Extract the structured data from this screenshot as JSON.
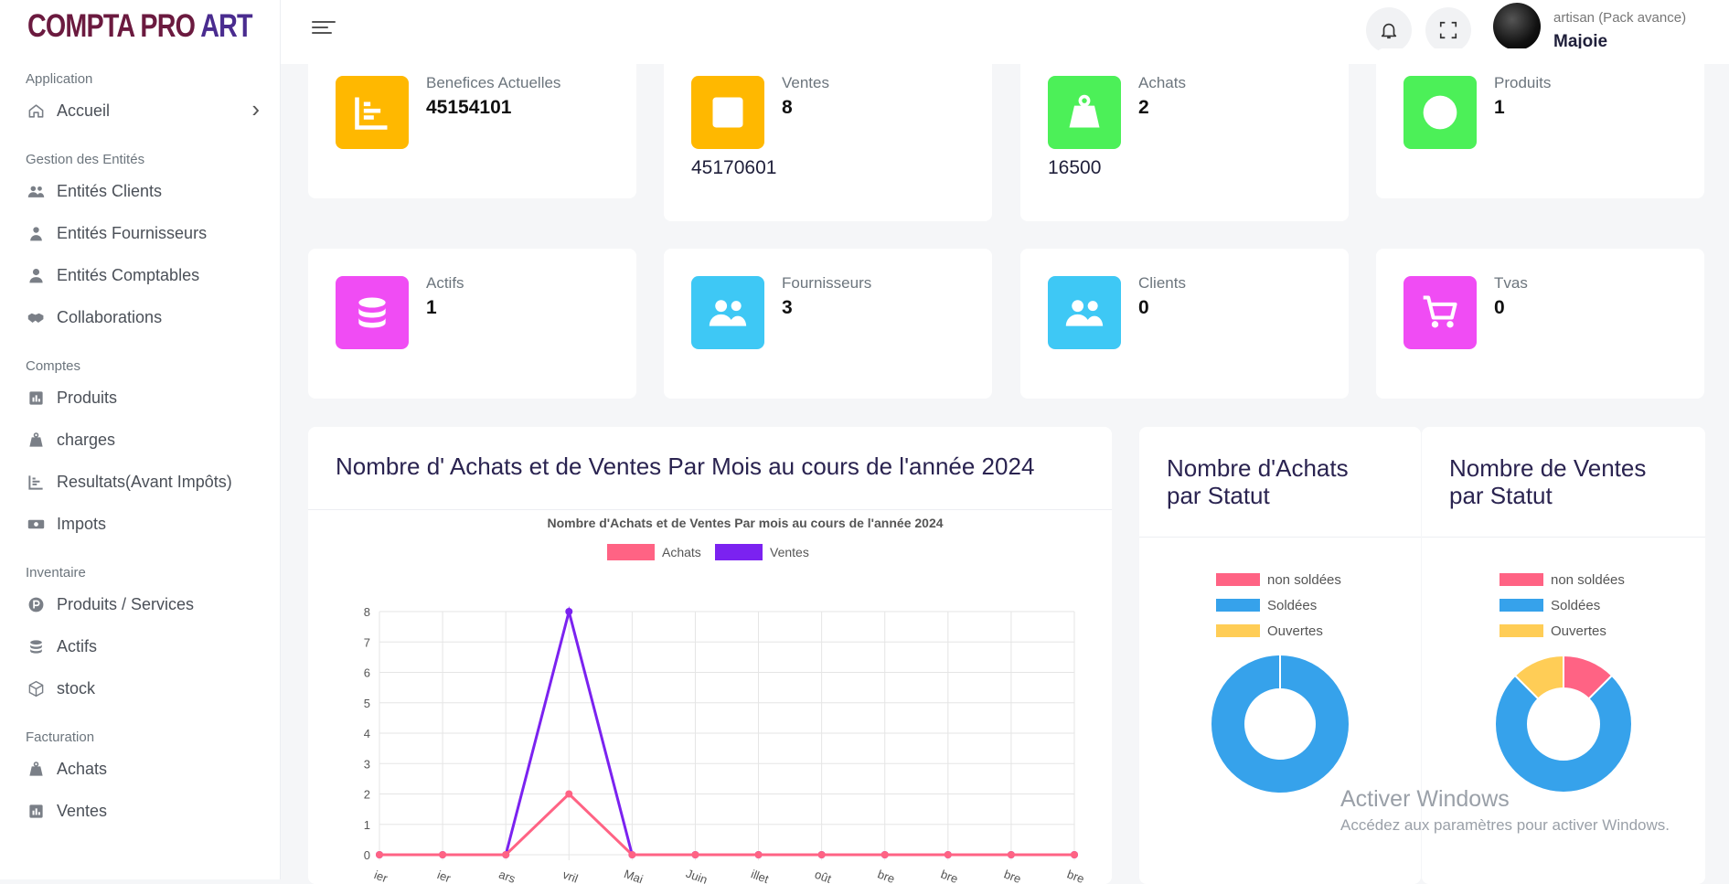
{
  "brand": {
    "name_main": "COMPTA PRO",
    "name_accent": "ART"
  },
  "sidebar": {
    "sections": [
      {
        "title": "Application",
        "items": [
          {
            "label": "Accueil",
            "icon": "home-icon"
          }
        ]
      },
      {
        "title": "Gestion des Entités",
        "items": [
          {
            "label": "Entités Clients",
            "icon": "users-icon"
          },
          {
            "label": "Entités Fournisseurs",
            "icon": "user-tie-icon"
          },
          {
            "label": "Entités Comptables",
            "icon": "user-icon"
          },
          {
            "label": "Collaborations",
            "icon": "handshake-icon"
          }
        ]
      },
      {
        "title": "Comptes",
        "items": [
          {
            "label": "Produits",
            "icon": "chart-bar-icon"
          },
          {
            "label": "charges",
            "icon": "weight-icon"
          },
          {
            "label": "Resultats(Avant Impôts)",
            "icon": "chart-line-icon"
          },
          {
            "label": "Impots",
            "icon": "money-icon"
          }
        ]
      },
      {
        "title": "Inventaire",
        "items": [
          {
            "label": "Produits / Services",
            "icon": "product-p-icon"
          },
          {
            "label": "Actifs",
            "icon": "coins-icon"
          },
          {
            "label": "stock",
            "icon": "box-icon"
          }
        ]
      },
      {
        "title": "Facturation",
        "items": [
          {
            "label": "Achats",
            "icon": "weight-icon"
          },
          {
            "label": "Ventes",
            "icon": "chart-bar-icon"
          }
        ]
      }
    ]
  },
  "topbar": {
    "user_role": "artisan (Pack avance)",
    "user_name": "Majoie"
  },
  "stats_row1": [
    {
      "label": "Benefices Actuelles",
      "value": "45154101",
      "extra": "",
      "color": "#ffb800",
      "icon": "chart-line-icon"
    },
    {
      "label": "Ventes",
      "value": "8",
      "extra": "45170601",
      "color": "#ffb800",
      "icon": "chart-bar-icon"
    },
    {
      "label": "Achats",
      "value": "2",
      "extra": "16500",
      "color": "#4cf058",
      "icon": "weight-icon"
    },
    {
      "label": "Produits",
      "value": "1",
      "extra": "",
      "color": "#4cf058",
      "icon": "product-p-icon"
    }
  ],
  "stats_row2": [
    {
      "label": "Actifs",
      "value": "1",
      "color": "#f04cf4",
      "icon": "coins-icon"
    },
    {
      "label": "Fournisseurs",
      "value": "3",
      "color": "#3ec8f5",
      "icon": "users-icon"
    },
    {
      "label": "Clients",
      "value": "0",
      "color": "#3ec8f5",
      "icon": "users-icon"
    },
    {
      "label": "Tvas",
      "value": "0",
      "color": "#f04cf4",
      "icon": "cart-icon"
    }
  ],
  "line_panel": {
    "title": "Nombre d' Achats et de Ventes Par Mois au cours de l'année 2024"
  },
  "donut_achats_panel": {
    "title_line1": "Nombre d'Achats",
    "title_line2": "par Statut"
  },
  "donut_ventes_panel": {
    "title_line1": "Nombre de Ventes",
    "title_line2": "par Statut"
  },
  "chart_data": [
    {
      "type": "line",
      "title": "Nombre d'Achats et de Ventes Par mois au cours de l'année 2024",
      "categories": [
        "Janvier",
        "Février",
        "Mars",
        "Avril",
        "Mai",
        "Juin",
        "Juillet",
        "Août",
        "Septembre",
        "Octobre",
        "Novembre",
        "Décembre"
      ],
      "category_labels_visible": [
        "ier",
        "ier",
        "ars",
        "vril",
        "Mai",
        "Juin",
        "illet",
        "oût",
        "bre",
        "bre",
        "bre",
        "bre"
      ],
      "series": [
        {
          "name": "Achats",
          "color": "#ff6384",
          "values": [
            0,
            0,
            0,
            2,
            0,
            0,
            0,
            0,
            0,
            0,
            0,
            0
          ]
        },
        {
          "name": "Ventes",
          "color": "#7b22f0",
          "values": [
            0,
            0,
            0,
            8,
            0,
            0,
            0,
            0,
            0,
            0,
            0,
            0
          ]
        }
      ],
      "ylim": [
        0,
        8
      ],
      "yticks": [
        "0",
        "1",
        "2",
        "3",
        "4",
        "5",
        "6",
        "7",
        "8"
      ],
      "grid": true,
      "legend": "top"
    },
    {
      "type": "pie",
      "variant": "doughnut",
      "labels": [
        "non soldées",
        "Soldées",
        "Ouvertes"
      ],
      "colors": [
        "#ff6384",
        "#36a2eb",
        "#ffcd56"
      ],
      "values": [
        0,
        100,
        0
      ],
      "legend": "top"
    },
    {
      "type": "pie",
      "variant": "doughnut",
      "labels": [
        "non soldées",
        "Soldées",
        "Ouvertes"
      ],
      "colors": [
        "#ff6384",
        "#36a2eb",
        "#ffcd56"
      ],
      "values": [
        12.5,
        75,
        12.5
      ],
      "legend": "top"
    }
  ],
  "watermark": {
    "line1": "Activer Windows",
    "line2": "Accédez aux paramètres pour activer Windows."
  }
}
